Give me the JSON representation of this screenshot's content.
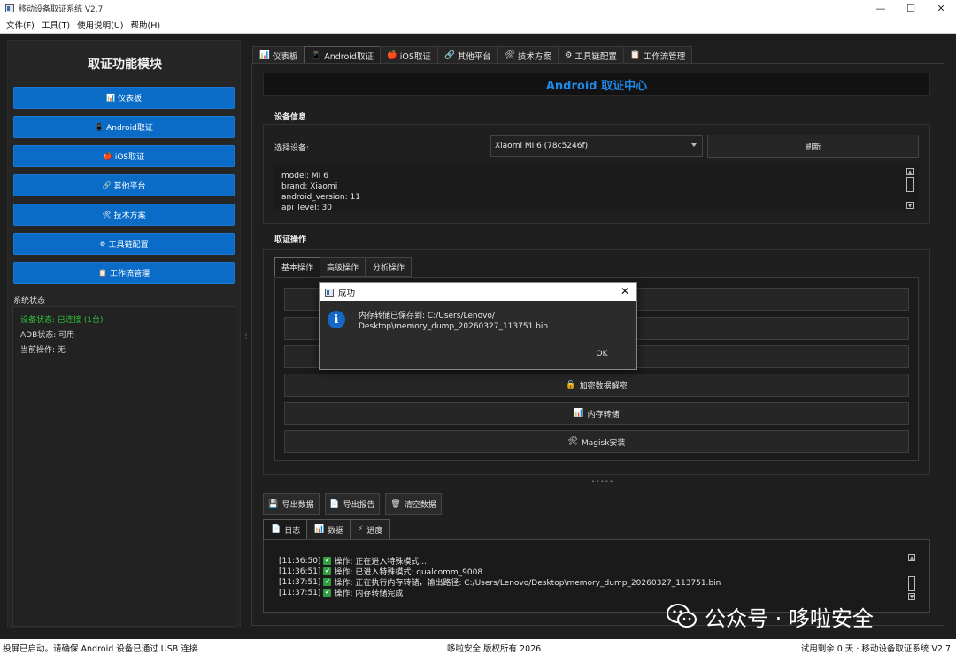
{
  "window": {
    "title": "移动设备取证系统 V2.7",
    "controls": {
      "minimize": "—",
      "maximize": "☐",
      "close": "✕"
    }
  },
  "menu": [
    "文件(F)",
    "工具(T)",
    "使用说明(U)",
    "帮助(H)"
  ],
  "sidebar": {
    "title": "取证功能模块",
    "buttons": [
      {
        "icon": "📊",
        "label": "仪表板"
      },
      {
        "icon": "📱",
        "label": "Android取证"
      },
      {
        "icon": "🍎",
        "label": "iOS取证"
      },
      {
        "icon": "🔗",
        "label": "其他平台"
      },
      {
        "icon": "🛠",
        "label": "技术方案"
      },
      {
        "icon": "⚙",
        "label": "工具链配置"
      },
      {
        "icon": "📋",
        "label": "工作流管理"
      }
    ],
    "status_title": "系统状态",
    "status": [
      "设备状态: 已连接 (1台)",
      "ADB状态: 可用",
      "当前操作: 无"
    ]
  },
  "tabs": [
    {
      "icon": "📊",
      "label": "仪表板"
    },
    {
      "icon": "📱",
      "label": "Android取证"
    },
    {
      "icon": "🍎",
      "label": "iOS取证"
    },
    {
      "icon": "🔗",
      "label": "其他平台"
    },
    {
      "icon": "🛠",
      "label": "技术方案"
    },
    {
      "icon": "⚙",
      "label": "工具链配置"
    },
    {
      "icon": "📋",
      "label": "工作流管理"
    }
  ],
  "main": {
    "header": "Android 取证中心",
    "device_group_label": "设备信息",
    "select_label": "选择设备:",
    "selected_device": "Xiaomi MI 6 (78c5246f)",
    "refresh_label": "刷新",
    "device_info": [
      "model: MI 6",
      "brand: Xiaomi",
      "android_version: 11",
      "api_level: 30"
    ],
    "ops_group_label": "取证操作",
    "subtabs": [
      "基本操作",
      "高级操作",
      "分析操作"
    ],
    "op_buttons": [
      {
        "icon": "",
        "label": ""
      },
      {
        "icon": "",
        "label": ""
      },
      {
        "icon": "",
        "label": ""
      },
      {
        "icon": "🔓",
        "label": "加密数据解密"
      },
      {
        "icon": "📊",
        "label": "内存转储"
      },
      {
        "icon": "🛠",
        "label": "Magisk安装"
      }
    ],
    "actions": [
      {
        "icon": "💾",
        "label": "导出数据"
      },
      {
        "icon": "📄",
        "label": "导出报告"
      },
      {
        "icon": "🗑",
        "label": "清空数据"
      }
    ],
    "log_tabs": [
      {
        "icon": "📄",
        "label": "日志"
      },
      {
        "icon": "📊",
        "label": "数据"
      },
      {
        "icon": "⚡",
        "label": "进度"
      }
    ],
    "logs": [
      {
        "time": "[11:36:50]",
        "text": "操作: 正在进入特殊模式..."
      },
      {
        "time": "[11:36:51]",
        "text": "操作: 已进入特殊模式: qualcomm_9008"
      },
      {
        "time": "[11:37:51]",
        "text": "操作: 正在执行内存转储，输出路径: C:/Users/Lenovo/Desktop\\memory_dump_20260327_113751.bin"
      },
      {
        "time": "[11:37:51]",
        "text": "操作: 内存转储完成"
      }
    ]
  },
  "dialog": {
    "title": "成功",
    "message_line1": "内存转储已保存到: C:/Users/Lenovo/",
    "message_line2": "Desktop\\memory_dump_20260327_113751.bin",
    "ok_label": "OK",
    "close": "✕",
    "info_glyph": "i"
  },
  "statusbar": {
    "left": "投屏已启动。请确保 Android 设备已通过 USB 连接",
    "center": "哆啦安全 版权所有 2026",
    "right": "试用剩余 0 天 · 移动设备取证系统 V2.7"
  },
  "watermark": {
    "text": "公众号 · 哆啦安全"
  }
}
